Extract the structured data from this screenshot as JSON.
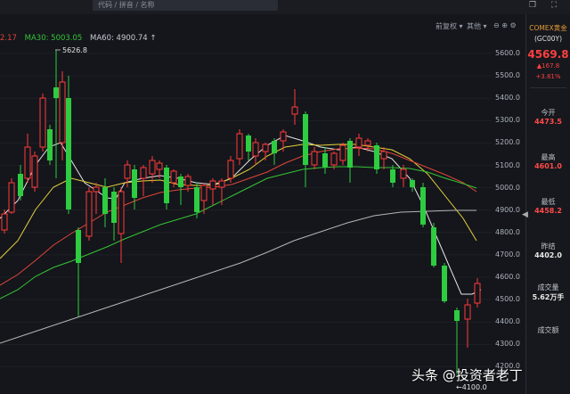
{
  "topbar": {
    "search_placeholder": "代码 / 拼音 / 名称"
  },
  "legend": {
    "ma_prev": "2.17",
    "ma30": "MA30: 5003.05",
    "ma60": "MA60: 4900.74 ↑"
  },
  "toolbar": {
    "adjust": "前复权",
    "other": "其他"
  },
  "annotations": {
    "high": "5626.8",
    "low": "4100.0"
  },
  "y_axis": [
    "5600.0",
    "5500.0",
    "5400.0",
    "5300.0",
    "5200.0",
    "5100.0",
    "5000.0",
    "4900.0",
    "4800.0",
    "4700.0",
    "4600.0",
    "4500.0",
    "4400.0",
    "4300.0",
    "4200.0"
  ],
  "side": {
    "title": "COMEX黄金",
    "code": "(GC00Y)",
    "price": "4569.8",
    "change": "167.8",
    "change_pct": "+3.81%",
    "open_label": "今开",
    "open_value": "4473.5",
    "high_label": "最高",
    "high_value": "4601.0",
    "low_label": "最低",
    "low_value": "4458.2",
    "prev_label": "昨结",
    "prev_value": "4402.0",
    "volume_label": "成交量",
    "volume_value": "5.62万手",
    "amount_label": "成交额"
  },
  "watermark": "头条 @投资者老丁",
  "colors": {
    "up": "#ff3b3b",
    "down": "#2ecc40",
    "ma_white": "#e6e6e6",
    "ma_yellow": "#e6d23a",
    "ma_red": "#e0453a",
    "ma_green": "#35c435",
    "ma_gray": "#b5b5b5"
  }
}
